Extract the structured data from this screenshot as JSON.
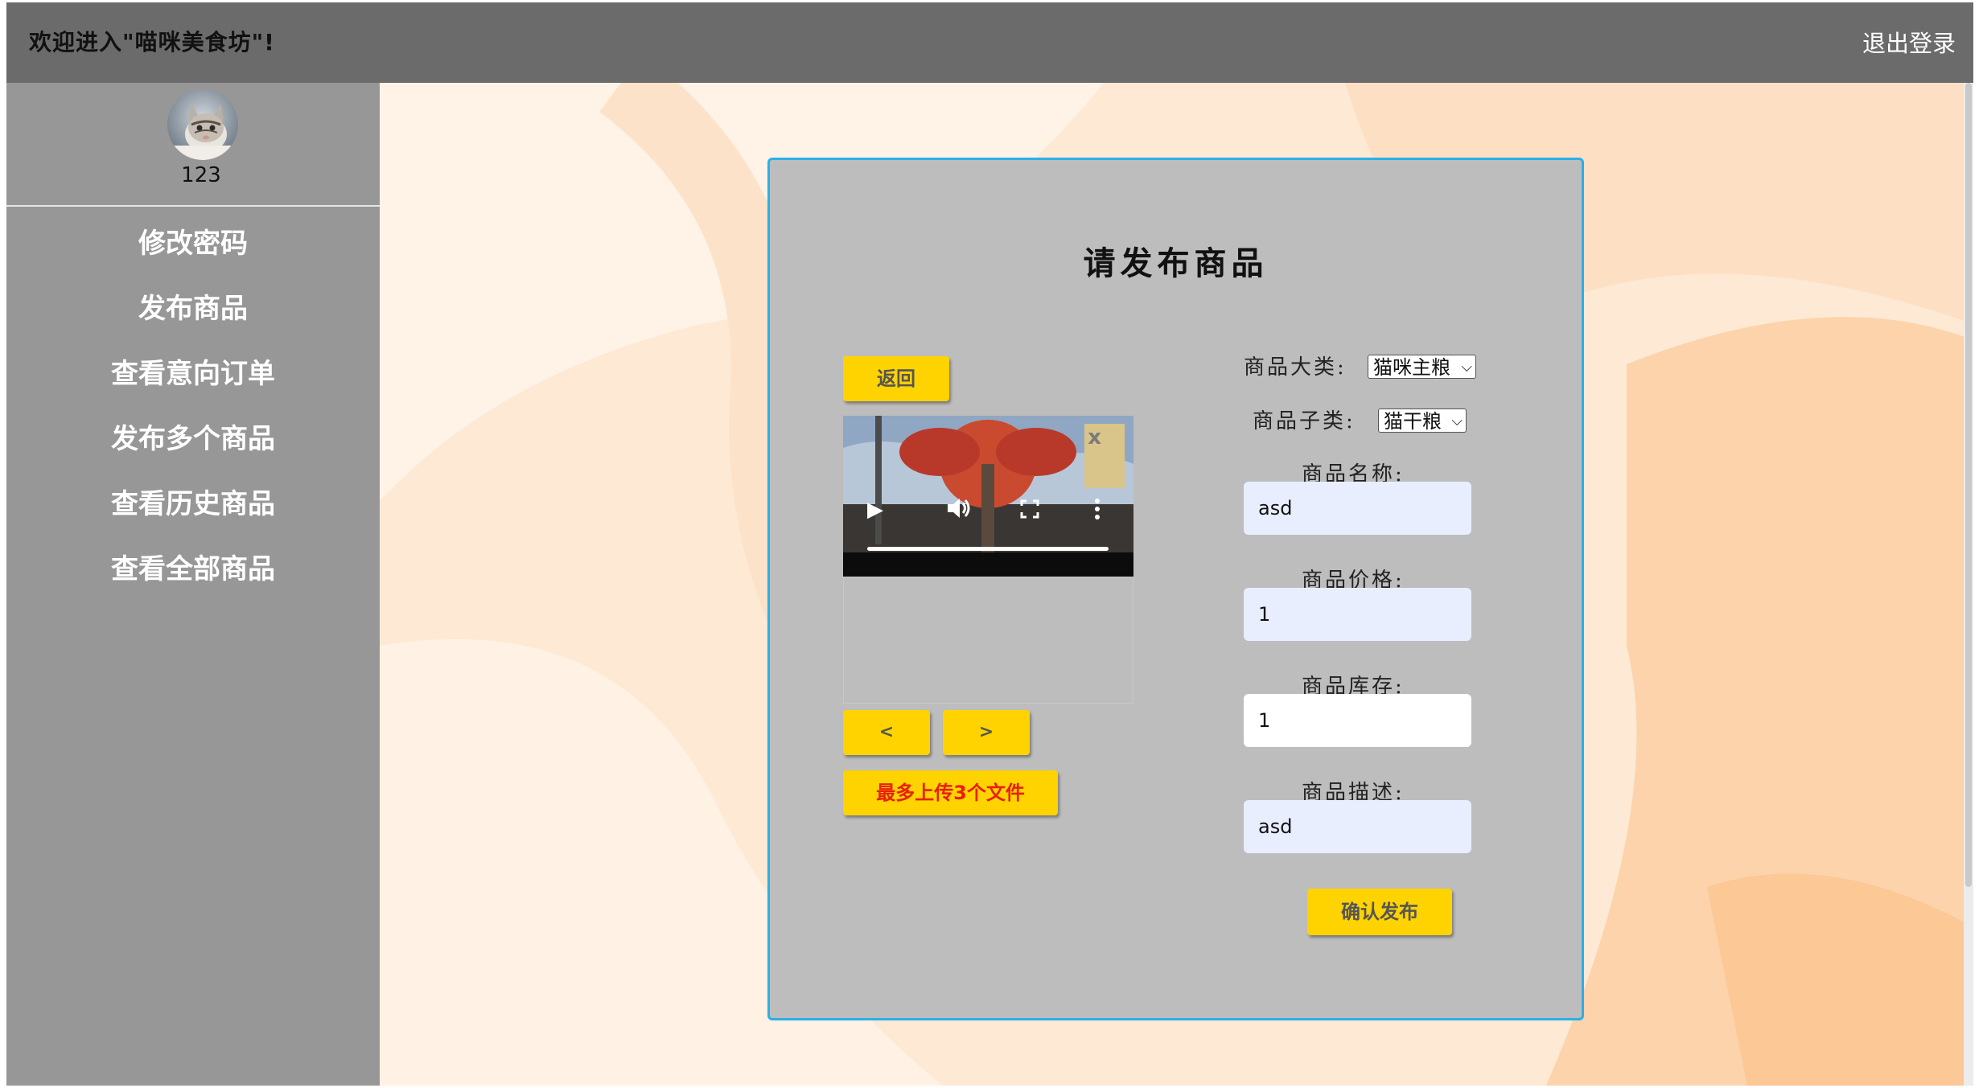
{
  "header": {
    "welcome": "欢迎进入\"喵咪美食坊\"!",
    "logout": "退出登录"
  },
  "user": {
    "name": "123",
    "avatar_icon": "cat-avatar-icon"
  },
  "sidebar": {
    "items": [
      {
        "label": "修改密码"
      },
      {
        "label": "发布商品"
      },
      {
        "label": "查看意向订单"
      },
      {
        "label": "发布多个商品"
      },
      {
        "label": "查看历史商品"
      },
      {
        "label": "查看全部商品"
      }
    ]
  },
  "panel": {
    "title": "请发布商品",
    "back_button": "返回",
    "prev_button": "<",
    "next_button": ">",
    "upload_button": "最多上传3个文件",
    "video": {
      "close_label": "x",
      "icons": [
        "play-icon",
        "volume-icon",
        "fullscreen-icon",
        "more-options-icon"
      ]
    },
    "form": {
      "category_label": "商品大类:",
      "category_value": "猫咪主粮",
      "subcategory_label": "商品子类:",
      "subcategory_value": "猫干粮",
      "name_label": "商品名称:",
      "name_value": "asd",
      "price_label": "商品价格:",
      "price_value": "1",
      "stock_label": "商品库存:",
      "stock_value": "1",
      "desc_label": "商品描述:",
      "desc_value": "asd",
      "submit_button": "确认发布"
    }
  },
  "colors": {
    "header_bg": "#6b6b6b",
    "sidebar_bg": "#979797",
    "panel_bg": "#bdbdbd",
    "panel_border": "#2ab0e8",
    "button_yellow": "#ffd300",
    "upload_text_red": "#e8200a",
    "input_bg": "#e8eefd"
  }
}
